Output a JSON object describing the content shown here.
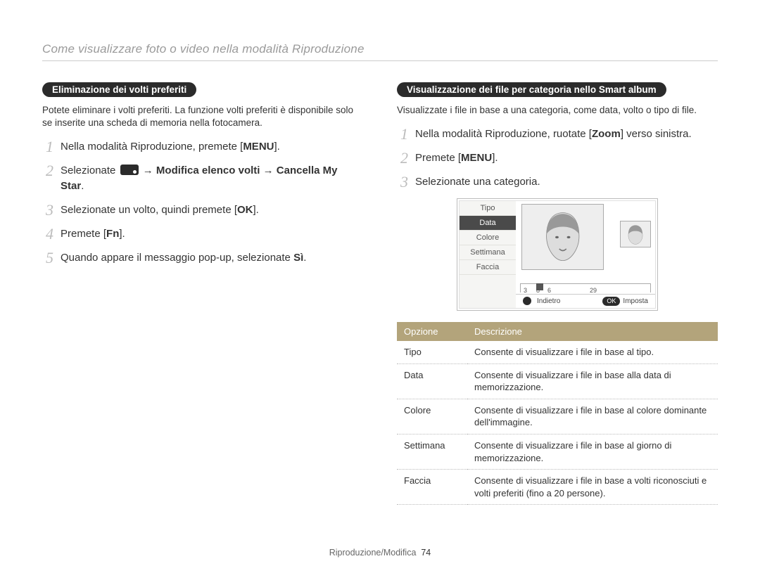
{
  "header": {
    "title": "Come visualizzare foto o video nella modalità Riproduzione"
  },
  "left": {
    "pill": "Eliminazione dei volti preferiti",
    "intro": "Potete eliminare i volti preferiti. La funzione volti preferiti è disponibile solo se inserite una scheda di memoria nella fotocamera.",
    "steps": [
      {
        "n": "1",
        "pre": "Nella modalità Riproduzione, premete [",
        "btn": "MENU",
        "post": "]."
      },
      {
        "n": "2",
        "pre": "Selezionate ",
        "icon": "display-icon",
        "arrow1": " → ",
        "bold1": "Modifica elenco volti",
        "arrow2": " → ",
        "bold2": "Cancella My Star",
        "post2": "."
      },
      {
        "n": "3",
        "pre": "Selezionate un volto, quindi premete [",
        "btn": "OK",
        "post": "]."
      },
      {
        "n": "4",
        "pre": "Premete [",
        "btn": "Fn",
        "post": "]."
      },
      {
        "n": "5",
        "pre": "Quando appare il messaggio pop-up, selezionate ",
        "bold1": "Sì",
        "post2": "."
      }
    ]
  },
  "right": {
    "pill": "Visualizzazione dei file per categoria nello Smart album",
    "intro": "Visualizzate i file in base a una categoria, come data, volto o tipo di file.",
    "steps": [
      {
        "n": "1",
        "pre": "Nella modalità Riproduzione, ruotate [",
        "bold_inline": "Zoom",
        "post": "] verso sinistra."
      },
      {
        "n": "2",
        "pre": "Premete [",
        "btn": "MENU",
        "post": "]."
      },
      {
        "n": "3",
        "pre": "Selezionate una categoria.",
        "post": ""
      }
    ],
    "screen": {
      "menu": [
        "Tipo",
        "Data",
        "Colore",
        "Settimana",
        "Faccia"
      ],
      "active_index": 1,
      "ruler_ticks": {
        "a": "3",
        "b": "8",
        "c": "6",
        "d": "29"
      },
      "footer_left": "Indietro",
      "footer_right": "Imposta",
      "footer_right_key": "OK"
    },
    "table": {
      "headers": [
        "Opzione",
        "Descrizione"
      ],
      "rows": [
        {
          "opt": "Tipo",
          "desc": "Consente di visualizzare i file in base al tipo."
        },
        {
          "opt": "Data",
          "desc": "Consente di visualizzare i file in base alla data di memorizzazione."
        },
        {
          "opt": "Colore",
          "desc": "Consente di visualizzare i file in base al colore dominante dell'immagine."
        },
        {
          "opt": "Settimana",
          "desc": "Consente di visualizzare i file in base al giorno di memorizzazione."
        },
        {
          "opt": "Faccia",
          "desc": "Consente di visualizzare i file in base a volti riconosciuti e volti preferiti (fino a 20 persone)."
        }
      ]
    }
  },
  "footer": {
    "section": "Riproduzione/Modifica",
    "page": "74"
  }
}
